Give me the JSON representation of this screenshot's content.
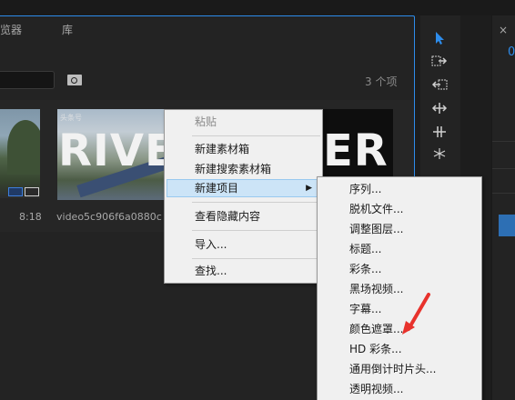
{
  "project_panel": {
    "tabs": [
      "浏览器",
      "库"
    ],
    "item_count": "3 个项",
    "clips": [
      {
        "duration": "8:18"
      },
      {
        "name": "video5c906f6a0880c",
        "title_text": "RIVE",
        "watermark": "头条号"
      },
      {
        "title_text": "ER"
      }
    ]
  },
  "context_menu": {
    "items": [
      {
        "label": "粘贴",
        "enabled": false
      },
      {
        "label": "新建素材箱",
        "enabled": true
      },
      {
        "label": "新建搜索素材箱",
        "enabled": true
      },
      {
        "label": "新建项目",
        "enabled": true,
        "has_submenu": true,
        "highlighted": true
      },
      {
        "label": "查看隐藏内容",
        "enabled": true
      },
      {
        "label": "导入...",
        "enabled": true
      },
      {
        "label": "查找...",
        "enabled": true
      }
    ]
  },
  "submenu": {
    "items": [
      "序列...",
      "脱机文件...",
      "调整图层...",
      "标题...",
      "彩条...",
      "黑场视频...",
      "字幕...",
      "颜色遮罩...",
      "HD 彩条...",
      "通用倒计时片头...",
      "透明视频..."
    ]
  },
  "tools": [
    "selection-tool",
    "track-select-forward-tool",
    "track-select-backward-tool",
    "ripple-edit-tool",
    "rolling-edit-tool"
  ],
  "colors": {
    "accent": "#2d8ceb",
    "annotation": "#e8322c",
    "menu_bg": "#f0f0f0",
    "menu_highlight": "#cce4f7"
  }
}
